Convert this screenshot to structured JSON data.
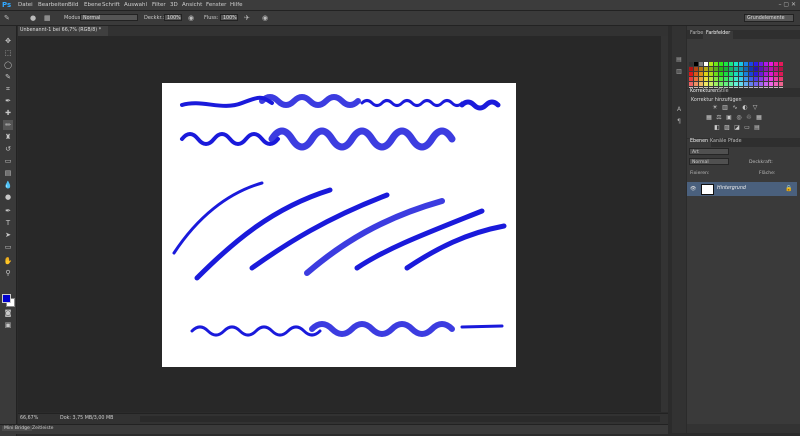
{
  "app": {
    "logo": "Ps"
  },
  "menu": [
    "Datei",
    "Bearbeiten",
    "Bild",
    "Ebene",
    "Schrift",
    "Auswahl",
    "Filter",
    "3D",
    "Ansicht",
    "Fenster",
    "Hilfe"
  ],
  "window_controls": "–  ▢  ✕",
  "options": {
    "mode_label": "Modus:",
    "mode_value": "Normal",
    "opacity_label": "Deckkr.:",
    "opacity_value": "100%",
    "flow_label": "Fluss:",
    "flow_value": "100%",
    "workspace": "Grundelemente"
  },
  "document": {
    "tab_title": "Unbenannt-1 bei 66,7% (RGB/8) *",
    "zoom": "66,67%",
    "doc_size": "Dok: 3,75 MB/3,00 MB"
  },
  "bottom_tabs": [
    "Mini Bridge",
    "Zeitleiste"
  ],
  "panels": {
    "color_tabs": [
      "Farbe",
      "Farbfelder"
    ],
    "adjust_tabs": [
      "Korrekturen",
      "Stile"
    ],
    "adjust_title": "Korrektur hinzufügen",
    "layer_tabs": [
      "Ebenen",
      "Kanäle",
      "Pfade"
    ],
    "kind_label": "Art",
    "blend_value": "Normal",
    "opacity_label": "Deckkraft:",
    "lock_label": "Fixieren:",
    "fill_label": "Fläche:",
    "layer_name": "Hintergrund"
  },
  "colors": {
    "foreground": "#0000cc",
    "background": "#ffffff",
    "stroke": "#1a1adb",
    "layer_selected": "#4a607d"
  },
  "icons": {
    "tools": [
      "move-icon",
      "marquee-icon",
      "lasso-icon",
      "quick-select-icon",
      "crop-icon",
      "eyedropper-icon",
      "healing-icon",
      "brush-icon",
      "stamp-icon",
      "history-brush-icon",
      "eraser-icon",
      "gradient-icon",
      "blur-icon",
      "dodge-icon",
      "pen-icon",
      "type-icon",
      "path-select-icon",
      "shape-icon",
      "hand-icon",
      "zoom-icon"
    ]
  }
}
